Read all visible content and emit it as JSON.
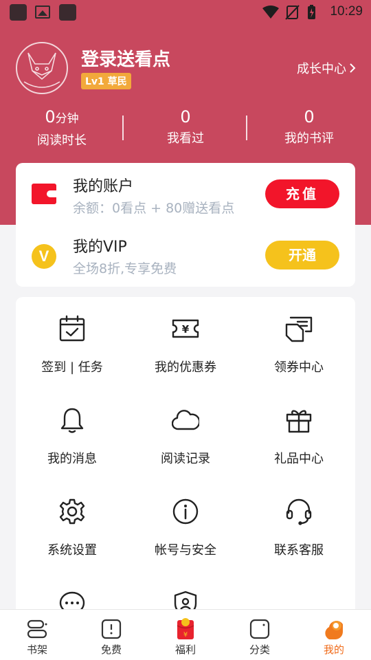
{
  "status_bar": {
    "time": "10:29"
  },
  "profile": {
    "login_title": "登录送看点",
    "level_badge": "Lv1 草民",
    "growth_link": "成长中心"
  },
  "stats": [
    {
      "value": "0",
      "unit": "分钟",
      "label": "阅读时长"
    },
    {
      "value": "0",
      "unit": "",
      "label": "我看过"
    },
    {
      "value": "0",
      "unit": "",
      "label": "我的书评"
    }
  ],
  "account": {
    "title": "我的账户",
    "balance": "余额：0看点 + 80赠送看点",
    "recharge_label": "充值"
  },
  "vip": {
    "title": "我的VIP",
    "subtitle": "全场8折,专享免费",
    "open_label": "开通",
    "icon_letter": "V"
  },
  "menu": [
    {
      "icon": "calendar-check-icon",
      "label": "签到 | 任务"
    },
    {
      "icon": "coupon-icon",
      "label": "我的优惠券"
    },
    {
      "icon": "coupon-center-icon",
      "label": "领券中心"
    },
    {
      "icon": "bell-icon",
      "label": "我的消息"
    },
    {
      "icon": "cloud-icon",
      "label": "阅读记录"
    },
    {
      "icon": "gift-icon",
      "label": "礼品中心"
    },
    {
      "icon": "gear-icon",
      "label": "系统设置"
    },
    {
      "icon": "info-icon",
      "label": "帐号与安全"
    },
    {
      "icon": "headset-icon",
      "label": "联系客服"
    },
    {
      "icon": "chat-icon",
      "label": ""
    },
    {
      "icon": "shield-user-icon",
      "label": ""
    }
  ],
  "coupon_symbol": "¥",
  "bottom_nav": [
    {
      "icon": "bookshelf-icon",
      "label": "书架",
      "active": false
    },
    {
      "icon": "free-book-icon",
      "label": "免费",
      "active": false
    },
    {
      "icon": "red-envelope-icon",
      "label": "福利",
      "active": false
    },
    {
      "icon": "category-icon",
      "label": "分类",
      "active": false
    },
    {
      "icon": "profile-icon",
      "label": "我的",
      "active": true
    }
  ],
  "colors": {
    "header": "#c8485e",
    "recharge": "#f2152a",
    "vip": "#f5c21c",
    "active_tab": "#f06b1a"
  }
}
